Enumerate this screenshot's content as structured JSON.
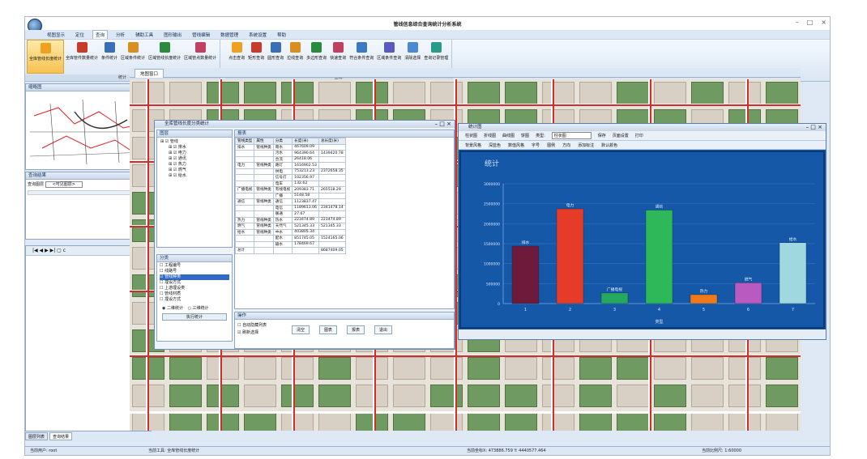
{
  "title": "管线信息综合查询统计分析系统",
  "menu": [
    "视图显示",
    "定位",
    "查询",
    "分析",
    "辅助工具",
    "图形输出",
    "管线编辑",
    "数据管理",
    "系统设置",
    "帮助"
  ],
  "menu_active": 2,
  "ribbon": {
    "group1": {
      "label": "统计",
      "buttons": [
        "全库管线长度统计",
        "全库管件数量统计",
        "条件统计",
        "区域条件统计",
        "区域管线长度统计",
        "区域管点数量统计"
      ]
    },
    "group2": {
      "label": "查询",
      "buttons": [
        "点击查询",
        "矩形查询",
        "圆形查询",
        "拉线查询",
        "多边形查询",
        "快速查询",
        "符合条件查询",
        "区域条件查询",
        "清除选择",
        "查询记录管理"
      ]
    }
  },
  "thumbnail": {
    "title": "缩略图"
  },
  "query_results": {
    "title": "查询结果",
    "scope_label": "查询图层",
    "scope_value": "<可见图层>"
  },
  "map_tab": "地图窗口",
  "stats_dialog": {
    "title": "全库管线长度分类统计",
    "layers_title": "图层",
    "layers": [
      "管线",
      "排水",
      "电力",
      "通讯",
      "热力",
      "燃气",
      "给水"
    ],
    "table_title": "报表",
    "headers": [
      "管线类型",
      "属性",
      "分类",
      "长度(米)",
      "总长度(米)"
    ],
    "rows": [
      [
        "排水",
        "管线种类",
        "雨水",
        "467609.09",
        ""
      ],
      [
        "",
        "",
        "污水",
        "964390.64",
        "1439420.78"
      ],
      [
        "",
        "",
        "合流",
        "26418.06",
        ""
      ],
      [
        "电力",
        "管线种类",
        "路灯",
        "1616902.53",
        ""
      ],
      [
        "",
        "",
        "供电",
        "753213.23",
        "2372658.35"
      ],
      [
        "",
        "",
        "信号灯",
        "102356.97",
        ""
      ],
      [
        "",
        "",
        "电车",
        "132.62",
        ""
      ],
      [
        "广播电视",
        "管线种类",
        "有线电视",
        "209383.71",
        "265518.29"
      ],
      [
        "",
        "",
        "广播",
        "5148.58",
        ""
      ],
      [
        "通信",
        "管线种类",
        "通信",
        "1123837.47",
        ""
      ],
      [
        "",
        "",
        "电信",
        "1189613.06",
        "2341478.14"
      ],
      [
        "",
        "",
        "联通",
        "27.67",
        ""
      ],
      [
        "热力",
        "管线种类",
        "热水",
        "223474.89",
        "223474.89"
      ],
      [
        "燃气",
        "管线种类",
        "天然气",
        "521345.33",
        "521345.33"
      ],
      [
        "给水",
        "管线种类",
        "中水",
        "403805.34",
        ""
      ],
      [
        "",
        "",
        "配水",
        "851745.05",
        "1524165.06"
      ],
      [
        "",
        "",
        "输水",
        "178469.67",
        ""
      ],
      [
        "总计",
        "",
        "",
        "",
        "8687409.05"
      ]
    ],
    "classify_title": "分类",
    "classify_items": [
      "工程编号",
      "线路号",
      "管线种类",
      "埋设方式",
      "上游埋设类",
      "管线材质",
      "埋设方式"
    ],
    "radio1": "二维统计",
    "radio2": "三维统计",
    "exec_button": "执行统计",
    "ops_title": "操作",
    "chk1": "自动隐藏列表",
    "chk2": "刷新选择",
    "btn_clear": "清空",
    "btn_chart": "图表",
    "btn_report": "报表",
    "btn_exit": "退出"
  },
  "stat_window": {
    "title": "统计图",
    "toolbar": [
      "柱状图",
      "折线图",
      "曲线图",
      "饼图",
      "类型:",
      "保存",
      "页面设置",
      "打印"
    ],
    "toolbar2": [
      "背景风格",
      "深蓝色",
      "数值风格",
      "字号",
      "图例",
      "方向",
      "添加标注",
      "默认颜色"
    ],
    "chart_type_value": "柱状图"
  },
  "chart_data": {
    "type": "bar",
    "title": "统计",
    "xlabel": "类型",
    "categories": [
      "1",
      "2",
      "3",
      "4",
      "5",
      "6",
      "7"
    ],
    "bar_labels": [
      "排水",
      "电力",
      "广播电视",
      "通信",
      "热力",
      "燃气",
      "给水"
    ],
    "values": [
      1439420.78,
      2372658.35,
      265518.29,
      2341478.14,
      223474.89,
      521345.33,
      1524165.06
    ],
    "colors": [
      "#6e1a3a",
      "#e53c2a",
      "#27a861",
      "#2fb85a",
      "#f07a1a",
      "#b85ac0",
      "#9fd9df"
    ],
    "yticks": [
      "0",
      "500000",
      "1000000",
      "1500000",
      "2000000",
      "2500000",
      "3000000"
    ],
    "ylim": [
      0,
      3000000
    ]
  },
  "layer_tabs": [
    "图层列表",
    "查询结果"
  ],
  "status": {
    "user": "当前用户: root",
    "tool": "当前工具: 全库管线长度统计",
    "coord": "当前坐标X: 473886.759  Y: 4440577.464",
    "scale": "当前比例尺: 1:60000"
  }
}
